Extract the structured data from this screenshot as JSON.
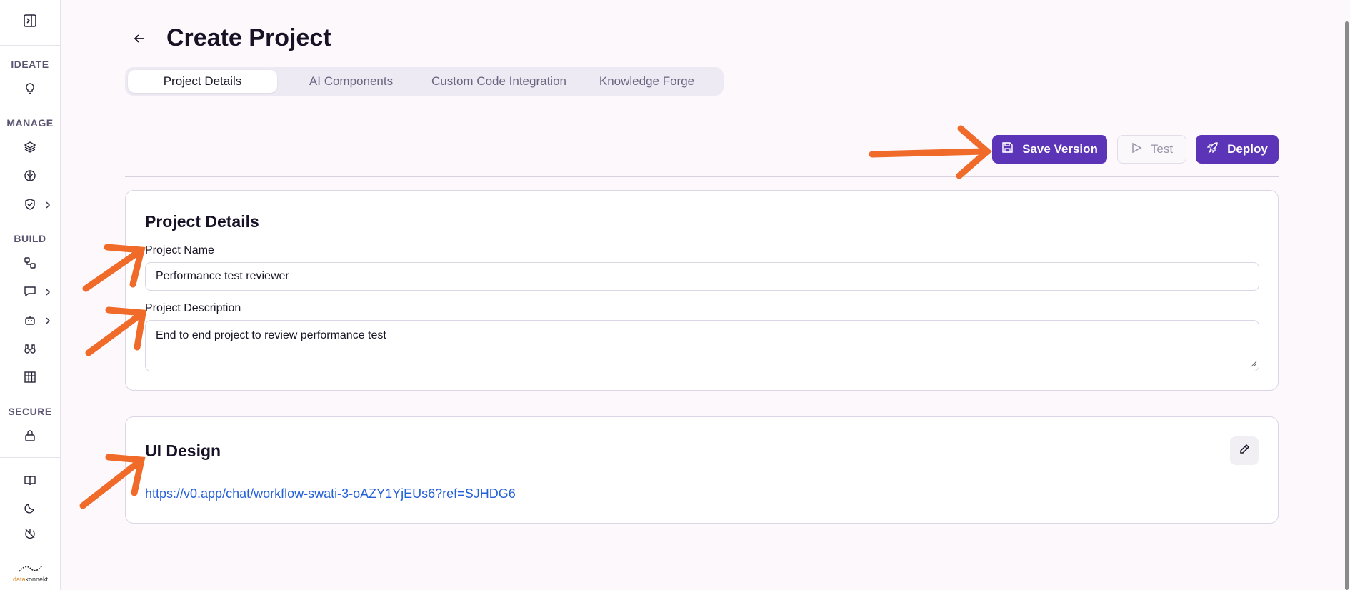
{
  "sidebar": {
    "sections": {
      "ideate": "IDEATE",
      "manage": "MANAGE",
      "build": "BUILD",
      "secure": "SECURE"
    },
    "logo": {
      "prefix": "data",
      "suffix": "konnekt"
    }
  },
  "header": {
    "title": "Create Project"
  },
  "tabs": [
    {
      "label": "Project Details",
      "active": true
    },
    {
      "label": "AI Components",
      "active": false
    },
    {
      "label": "Custom Code Integration",
      "active": false
    },
    {
      "label": "Knowledge Forge",
      "active": false
    }
  ],
  "toolbar": {
    "save_label": "Save Version",
    "test_label": "Test",
    "deploy_label": "Deploy"
  },
  "project_details": {
    "title": "Project Details",
    "name_label": "Project Name",
    "name_value": "Performance test reviewer",
    "description_label": "Project Description",
    "description_value": "End to end project to review performance test"
  },
  "ui_design": {
    "title": "UI Design",
    "link": "https://v0.app/chat/workflow-swati-3-oAZY1YjEUs6?ref=SJHDG6"
  },
  "colors": {
    "accent": "#5b34b8",
    "annotation": "#f06a2a",
    "link": "#2460d8"
  }
}
